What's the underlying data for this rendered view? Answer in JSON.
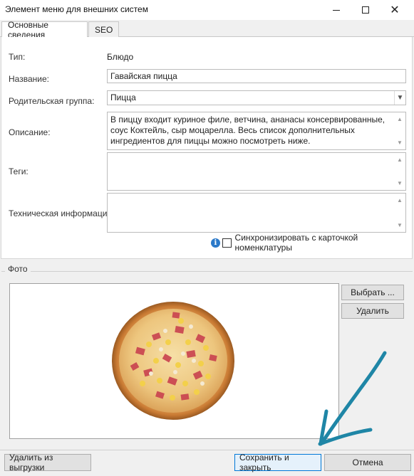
{
  "window": {
    "title": "Элемент меню для внешних систем",
    "close_glyph": "✕"
  },
  "tabs": [
    {
      "label": "Основные сведения"
    },
    {
      "label": "SEO"
    }
  ],
  "form": {
    "type_label": "Тип:",
    "type_value": "Блюдо",
    "name_label": "Название:",
    "name_value": "Гавайская пицца",
    "parent_label": "Родительская группа:",
    "parent_value": "Пицца",
    "description_label": "Описание:",
    "description_value": "В пиццу входит куриное филе, ветчина, ананасы консервированные, соус Коктейль, сыр моцарелла. Весь список дополнительных ингредиентов для пиццы можно посмотреть ниже.",
    "tags_label": "Теги:",
    "tags_value": "",
    "tech_label": "Техническая информация:",
    "tech_value": "",
    "sync_label": "Синхронизировать с карточкой номенклатуры",
    "sync_checked": false,
    "info_glyph": "i"
  },
  "photo": {
    "legend": "Фото",
    "choose_button": "Выбрать ...",
    "delete_button": "Удалить"
  },
  "footer": {
    "remove_button": "Удалить из выгрузки",
    "save_button": "Сохранить и закрыть",
    "cancel_button": "Отмена"
  },
  "colors": {
    "accent": "#0078d7",
    "annotation_arrow": "#1f86a6",
    "info_icon": "#2b79c9"
  }
}
